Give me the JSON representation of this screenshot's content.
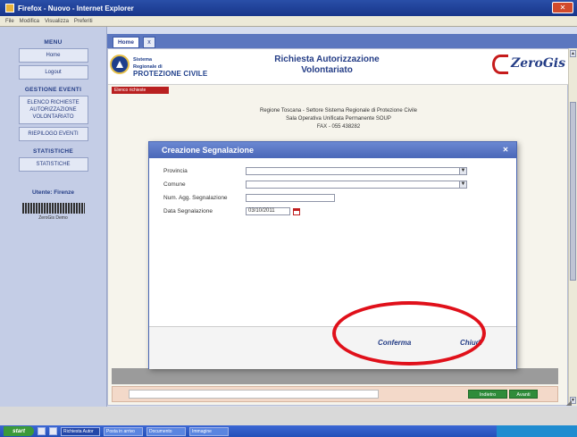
{
  "window": {
    "title": "Firefox - Nuovo - Internet Explorer"
  },
  "menubar": {
    "items": [
      "File",
      "Modifica",
      "Visualizza",
      "Preferiti"
    ]
  },
  "sidebar": {
    "sections": [
      {
        "title": "MENU",
        "items": [
          "Home",
          "Logout"
        ]
      },
      {
        "title": "GESTIONE EVENTI",
        "items": [
          "ELENCO RICHIESTE AUTORIZZAZIONE VOLONTARIATO",
          "RIEPILOGO EVENTI"
        ]
      },
      {
        "title": "STATISTICHE",
        "items": [
          "STATISTICHE"
        ]
      }
    ],
    "user": {
      "label": "Utente: Firenze",
      "logo_caption": "ZeroGis Demo"
    }
  },
  "tabs": {
    "home": "Home",
    "close": "x"
  },
  "header": {
    "org_line1": "Sistema",
    "org_line2": "Regionale di",
    "org_line3": "PROTEZIONE CIVILE",
    "title_line1": "Richiesta Autorizzazione",
    "title_line2": "Volontariato",
    "brand": "ZeroGis"
  },
  "content": {
    "red_strip": "Elenco richieste",
    "lines": [
      "Regione Toscana - Settore Sistema Regionale di Protezione Civile",
      "Sala Operativa Unificata Permanente SOUP",
      "FAX - 055 438282"
    ]
  },
  "modal": {
    "title": "Creazione Segnalazione",
    "fields": [
      {
        "label": "Provincia",
        "value": ""
      },
      {
        "label": "Comune",
        "value": ""
      },
      {
        "label": "Num. Agg. Segnalazione",
        "value": ""
      },
      {
        "label": "Data Segnalazione",
        "value": "03/10/2011"
      }
    ],
    "confirm_label": "Conferma",
    "close_label": "Chiudi"
  },
  "bottom": {
    "btn1": "Indietro",
    "btn2": "Avanti"
  },
  "taskbar": {
    "start": "start",
    "items": [
      "Richiesta Autor",
      "Posta in arrivo",
      "Documento",
      "Immagine"
    ]
  },
  "colors": {
    "accent": "#4a67b8",
    "highlight": "#e0101a",
    "brand_red": "#c61b1b"
  }
}
